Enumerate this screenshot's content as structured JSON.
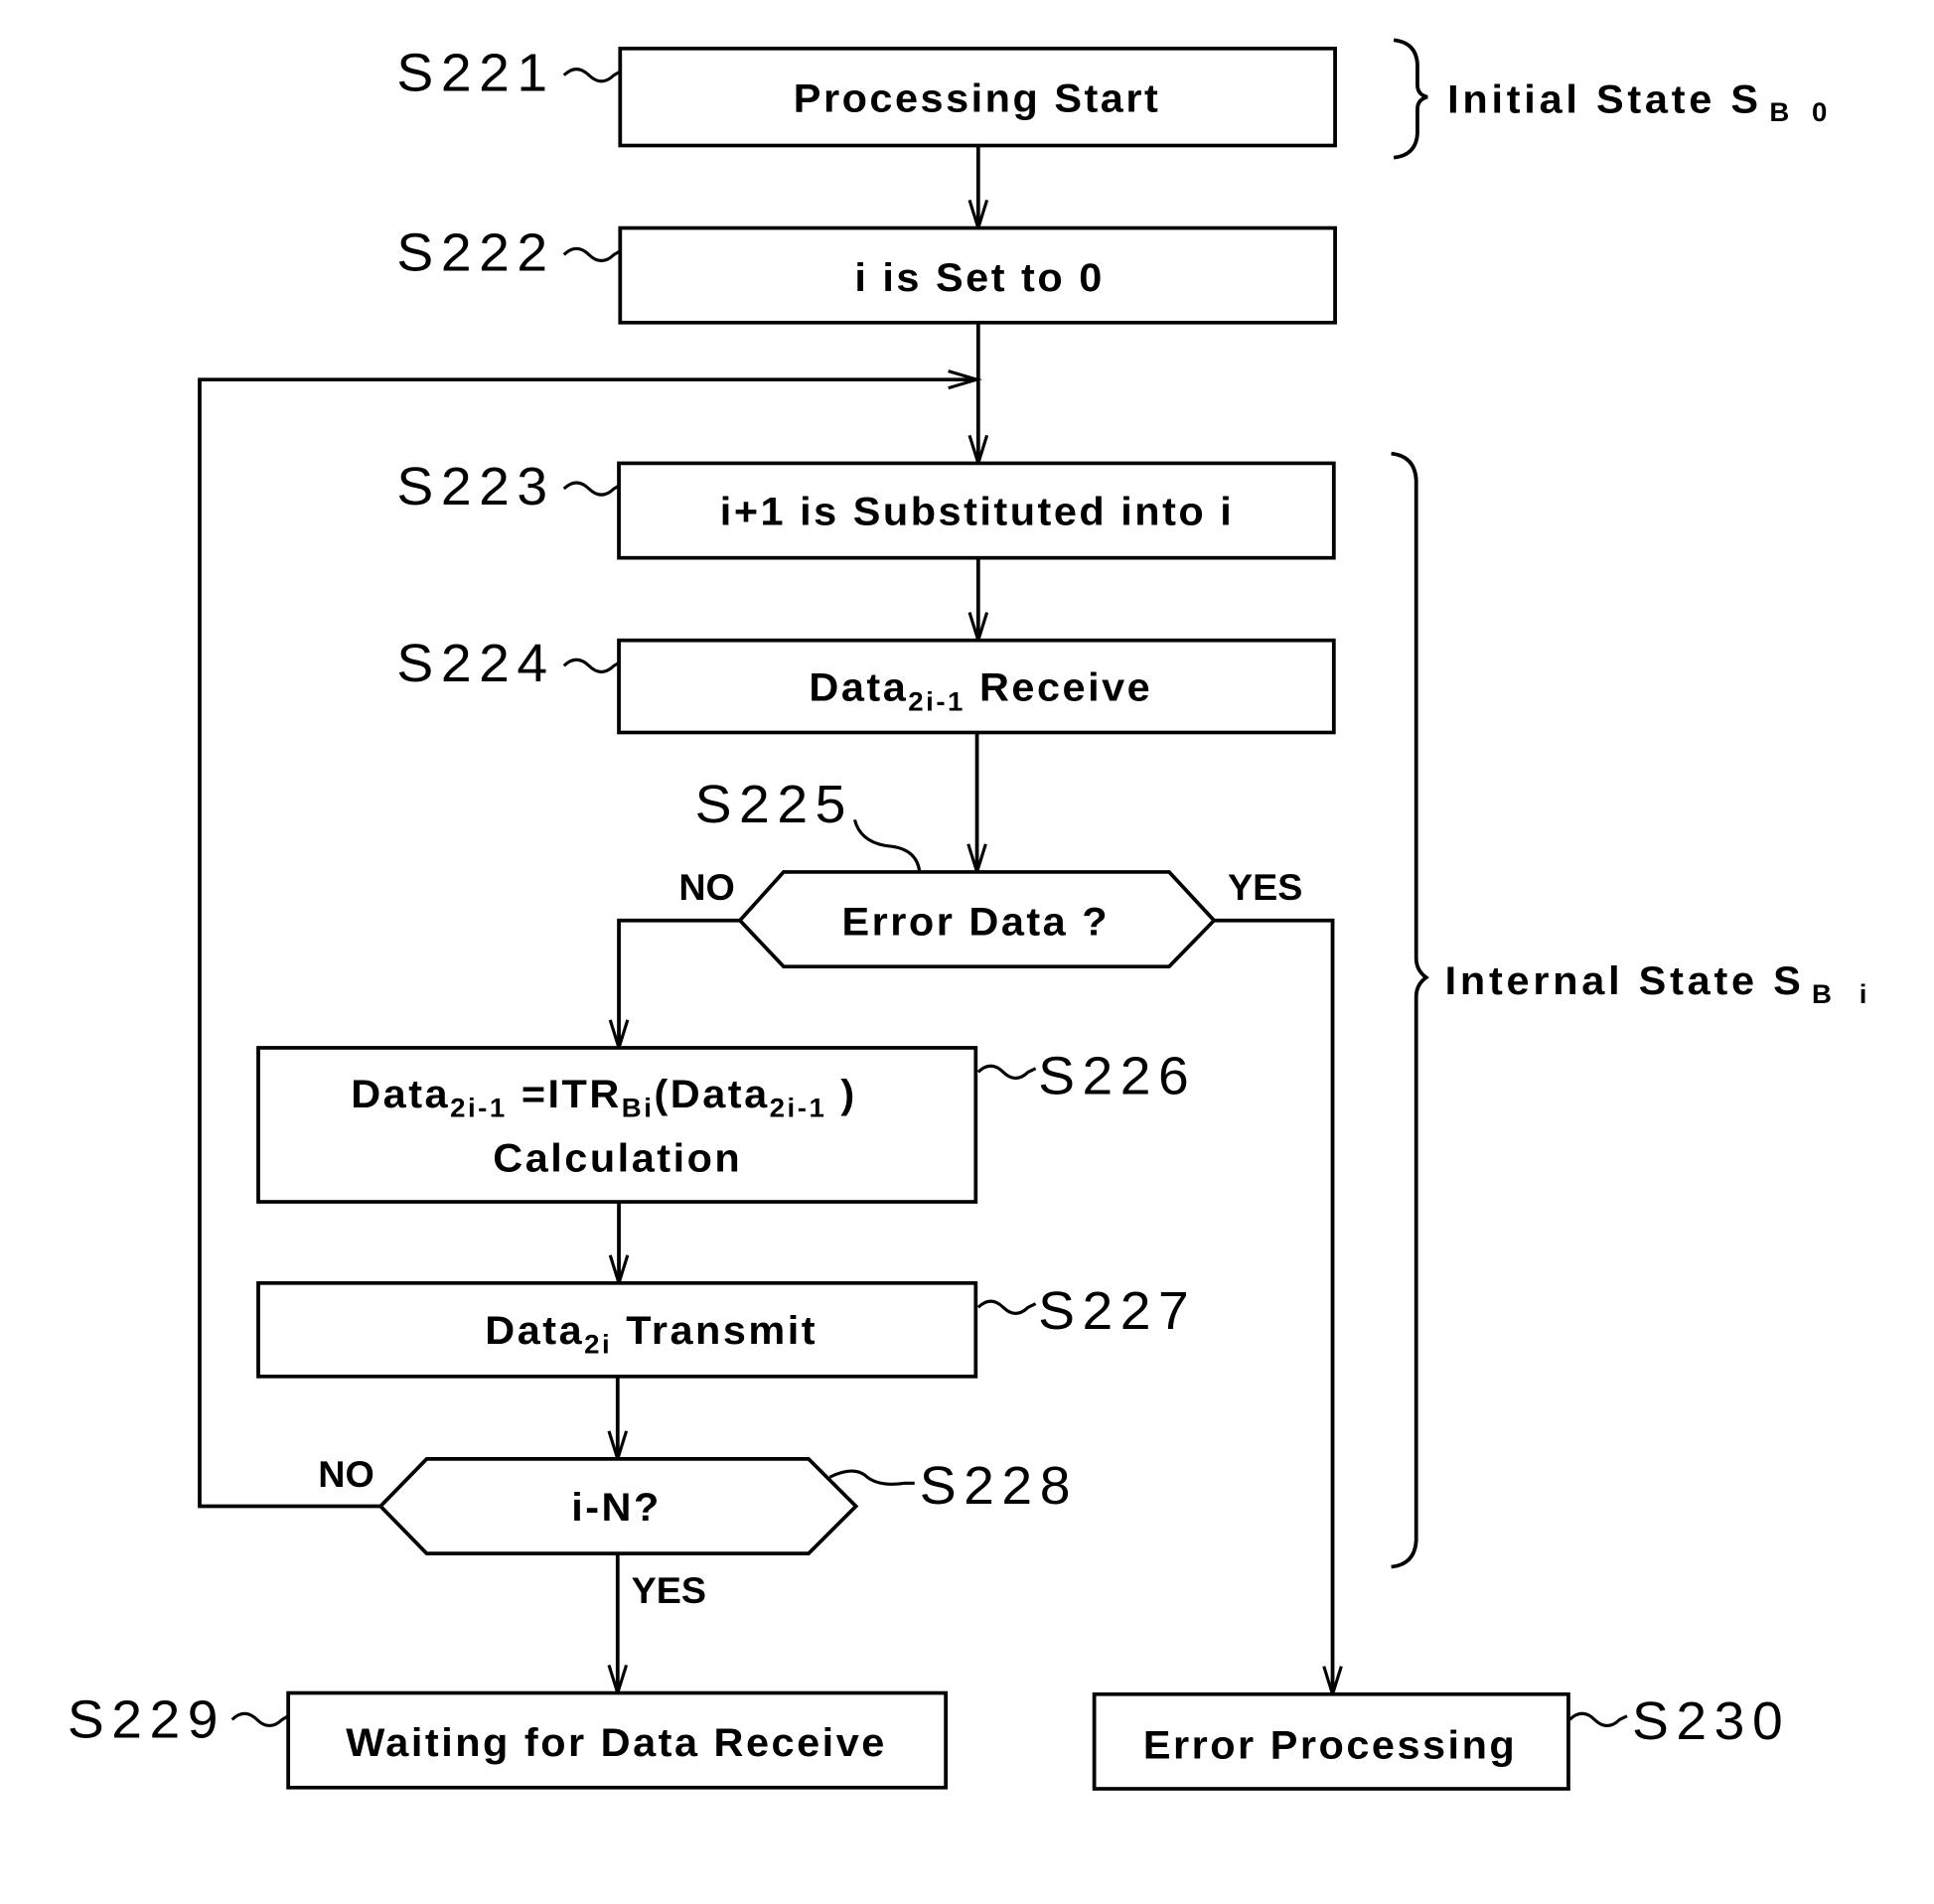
{
  "diagram": {
    "type": "flowchart",
    "colors": {
      "stroke": "#000000",
      "background": "#ffffff"
    },
    "steps": {
      "s221": {
        "id": "S221",
        "label": "Processing Start"
      },
      "s222": {
        "id": "S222",
        "label": "i is Set to 0"
      },
      "s223": {
        "id": "S223",
        "label": "i+1 is Substituted into i"
      },
      "s224": {
        "id": "S224",
        "label_main": "Data",
        "label_sub": "2i-1",
        "label_tail": " Receive"
      },
      "s225": {
        "id": "S225",
        "label": "Error Data ?",
        "no": "NO",
        "yes": "YES"
      },
      "s226": {
        "id": "S226",
        "line1_a": "Data",
        "line1_a_sub": "2i-1",
        "line1_b": " =ITR",
        "line1_b_sub": "Bi",
        "line1_c": "(Data",
        "line1_c_sub": "2i-1",
        "line1_d": " )",
        "line2": "Calculation"
      },
      "s227": {
        "id": "S227",
        "label_main": "Data",
        "label_sub": "2i",
        "label_tail": " Transmit"
      },
      "s228": {
        "id": "S228",
        "label": "i-N?",
        "no": "NO",
        "yes": "YES"
      },
      "s229": {
        "id": "S229",
        "label": "Waiting for Data Receive"
      },
      "s230": {
        "id": "S230",
        "label": "Error Processing"
      }
    },
    "states": {
      "initial": {
        "label": "Initial State S",
        "sub": "B 0"
      },
      "internal": {
        "label": "Internal State S",
        "sub": "B i"
      }
    }
  }
}
